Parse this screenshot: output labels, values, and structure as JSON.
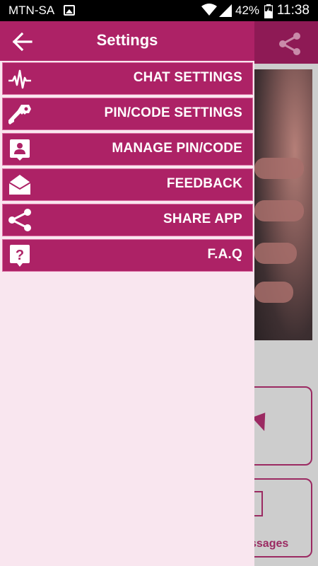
{
  "status_bar": {
    "carrier": "MTN-SA",
    "battery_percent": "42%",
    "time": "11:38"
  },
  "drawer": {
    "title": "Settings",
    "items": [
      {
        "label": "CHAT SETTINGS",
        "icon": "pulse-icon"
      },
      {
        "label": "PIN/CODE SETTINGS",
        "icon": "key-icon"
      },
      {
        "label": "MANAGE PIN/CODE",
        "icon": "contact-icon"
      },
      {
        "label": "FEEDBACK",
        "icon": "mail-open-icon"
      },
      {
        "label": "SHARE APP",
        "icon": "share-icon"
      },
      {
        "label": "F.A.Q",
        "icon": "help-icon"
      }
    ]
  },
  "background": {
    "card_text": "ssages"
  },
  "colors": {
    "accent": "#ad2266",
    "drawer_bg": "#f9e6ef",
    "status_bar": "#000000"
  }
}
